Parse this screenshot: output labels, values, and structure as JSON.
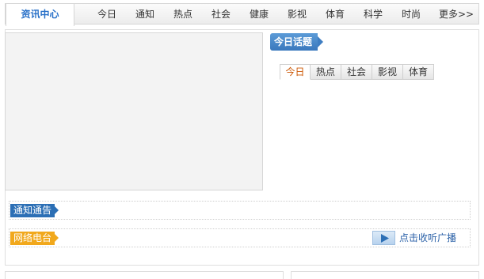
{
  "nav": {
    "home": "资讯中心",
    "items": [
      "今日",
      "通知",
      "热点",
      "社会",
      "健康",
      "影视",
      "体育",
      "科学",
      "时尚",
      "更多>>"
    ]
  },
  "topic": {
    "badge": "今日话题"
  },
  "subtabs": [
    "今日",
    "热点",
    "社会",
    "影视",
    "体育"
  ],
  "notice": {
    "label": "通知通告"
  },
  "radio": {
    "label": "网络电台",
    "listen": "点击收听广播"
  },
  "colors": {
    "accent": "#2c6fb5",
    "radio": "#f1a81c",
    "active_tab": "#cc5500"
  }
}
